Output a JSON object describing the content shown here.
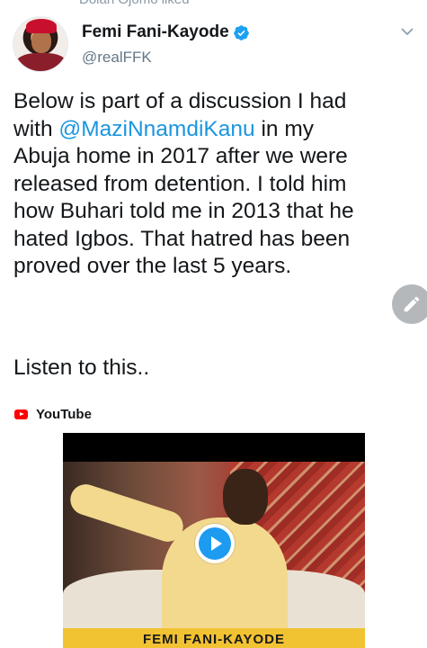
{
  "social_context": "Dolan Ojomo liked",
  "author": {
    "display_name": "Femi Fani-Kayode",
    "handle": "@realFFK",
    "verified": true,
    "avatar_icon": "profile-photo"
  },
  "tweet": {
    "lines": [
      {
        "pre": "Below is part of a discussion I had",
        "mention": "",
        "post": ""
      },
      {
        "pre": "with ",
        "mention": "@MaziNnamdiKanu",
        "post": " in my"
      },
      {
        "pre": "Abuja home in 2017 after we were",
        "mention": "",
        "post": ""
      },
      {
        "pre": "released from detention. I told him",
        "mention": "",
        "post": ""
      },
      {
        "pre": "how Buhari told me in 2013 that he",
        "mention": "",
        "post": ""
      },
      {
        "pre": "hated Igbos. That hatred has been",
        "mention": "",
        "post": ""
      },
      {
        "pre": "proved over the last 5 years.",
        "mention": "",
        "post": ""
      }
    ],
    "closing": "Listen to this.."
  },
  "card": {
    "source": "YouTube",
    "video_banner": "FEMI FANI-KAYODE"
  },
  "icons": {
    "verified": "verified-badge-icon",
    "caret": "chevron-down-icon",
    "compose": "pencil-icon",
    "play": "play-icon",
    "youtube": "youtube-logo-icon"
  },
  "colors": {
    "link": "#1b95e0",
    "verified": "#1da1f2",
    "youtube": "#ff0000",
    "banner": "#f1c232"
  }
}
